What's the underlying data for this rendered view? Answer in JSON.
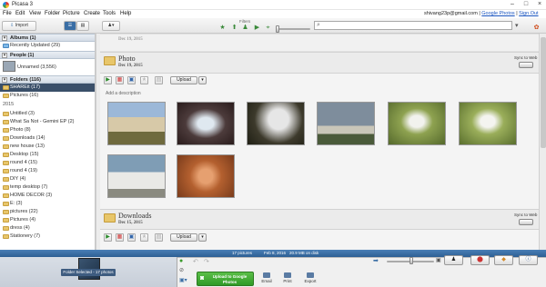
{
  "app": {
    "title": "Picasa 3"
  },
  "menu": [
    "File",
    "Edit",
    "View",
    "Folder",
    "Picture",
    "Create",
    "Tools",
    "Help"
  ],
  "account": {
    "email": "shivang23p@gmail.com",
    "separator": "|",
    "google_photos": "Google Photos",
    "sign_out": "Sign Out"
  },
  "toolbar": {
    "import_label": "Import",
    "filters_label": "Filters"
  },
  "sidebar": {
    "albums": "Albums (1)",
    "recently_updated": "Recently Updated (29)",
    "people": "People (1)",
    "unnamed": "Unnamed (3,556)",
    "folders": "Folders (116)",
    "shared": "SHAREit (17)",
    "pictures16": "Pictures (16)",
    "year": "2015",
    "items": [
      "Untitled (3)",
      "What Sa Not - Gemini EP (2)",
      "Photo (8)",
      "Downloads (14)",
      "new house (13)",
      "Desktop (15)",
      "round 4 (15)",
      "round 4 (19)",
      "DIY (4)",
      "temp desktop (7)",
      "HOME DECOR (3)",
      "E: (3)",
      "pictures (22)",
      "Pictures (4)",
      "dress (4)",
      "Stationery (7)"
    ]
  },
  "main": {
    "top_collapsed": "Dec 19, 2015",
    "album1": {
      "title": "Photo",
      "date": "Dec 19, 2015",
      "sync": "Sync to Web",
      "upload": "Upload",
      "description_placeholder": "Add a description"
    },
    "album2": {
      "title": "Downloads",
      "date": "Dec 15, 2015",
      "sync": "Sync to Web",
      "upload": "Upload"
    }
  },
  "status": {
    "pictures": "17 pictures",
    "date": "Feb 8, 2016",
    "size": "20.9 MB on disk"
  },
  "tray": {
    "selected_label": "Folder Selected - 17 photos"
  },
  "actions": {
    "upload_google": "Upload to Google Photos",
    "email": "Email",
    "print": "Print",
    "export": "Export"
  },
  "colors": {
    "status_bar": "#3a6ea5",
    "selected_folder": "#3a4f69",
    "upload_green": "#43a83a"
  }
}
